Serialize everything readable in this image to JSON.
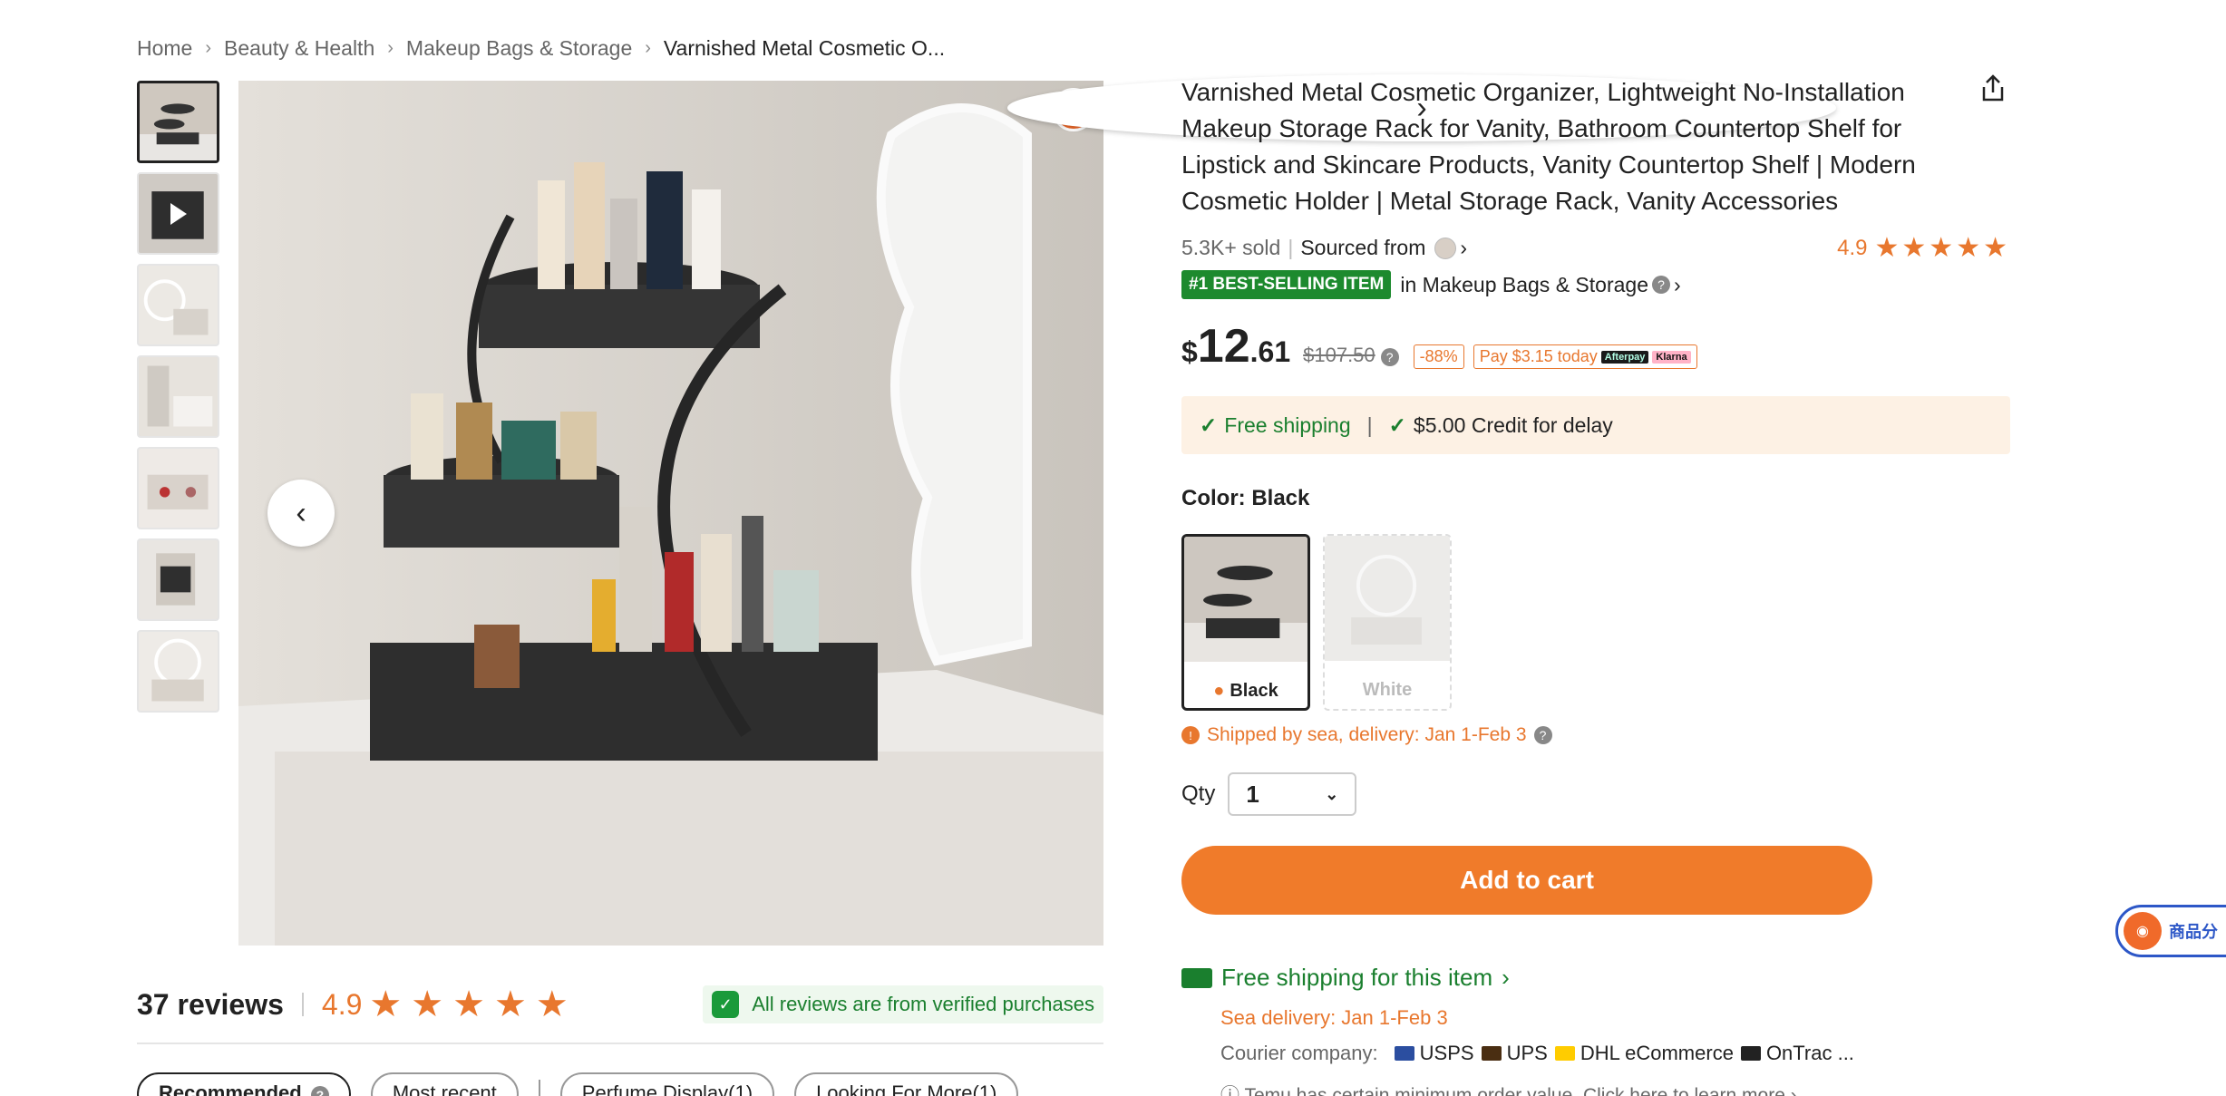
{
  "breadcrumb": {
    "items": [
      "Home",
      "Beauty & Health",
      "Makeup Bags & Storage",
      "Varnished Metal Cosmetic O..."
    ]
  },
  "thumbnails": {
    "count": 7,
    "video_index": 1
  },
  "product": {
    "title": "Varnished Metal Cosmetic Organizer, Lightweight No-Installation Makeup Storage Rack for Vanity, Bathroom Countertop Shelf for Lipstick and Skincare Products, Vanity Countertop Shelf | Modern Cosmetic Holder | Metal Storage Rack, Vanity Accessories",
    "sold": "5.3K+ sold",
    "sourced_from": "Sourced from",
    "rating": "4.9",
    "stars": "★★★★★",
    "best_badge": "#1 BEST-SELLING ITEM",
    "best_in": "in Makeup Bags & Storage"
  },
  "price": {
    "currency": "$",
    "integer": "12",
    "decimal": ".61",
    "original": "$107.50",
    "discount": "-88%",
    "pay_today": "Pay $3.15 today",
    "afterpay_logo": "Afterpay",
    "klarna_logo": "Klarna"
  },
  "shipping_box": {
    "free_shipping": "Free shipping",
    "separator": "|",
    "credit": "$5.00 Credit for delay"
  },
  "color": {
    "label": "Color: Black",
    "options": [
      "Black",
      "White"
    ],
    "selected": "Black"
  },
  "sea_shipping": "Shipped by sea, delivery: Jan 1-Feb 3",
  "quantity": {
    "label": "Qty",
    "value": "1"
  },
  "add_to_cart": "Add to cart",
  "delivery": {
    "link": "Free shipping for this item",
    "sea_delivery": "Sea delivery: Jan 1-Feb 3",
    "courier_label": "Courier company:",
    "couriers": [
      "USPS",
      "UPS",
      "DHL eCommerce",
      "OnTrac ..."
    ],
    "min_order": "Temu has certain minimum order value. Click here to learn more"
  },
  "reviews": {
    "count": "37 reviews",
    "rating": "4.9",
    "stars": "★★★★★",
    "verified": "All reviews are from verified purchases",
    "filters": [
      "Recommended",
      "Most recent",
      "Perfume Display(1)",
      "Looking For More(1)"
    ]
  },
  "floating_badge": {
    "text": "商品分"
  },
  "colors": {
    "accent_orange": "#f07b2a",
    "green": "#1a7f2e",
    "badge_green": "#1d8a2e",
    "shipping_bg": "#fdf1e4"
  },
  "icons": {
    "share": "share-icon",
    "prev": "chevron-left-icon",
    "next": "chevron-right-icon",
    "check": "check-icon",
    "truck": "truck-icon",
    "shield": "shield-icon"
  }
}
